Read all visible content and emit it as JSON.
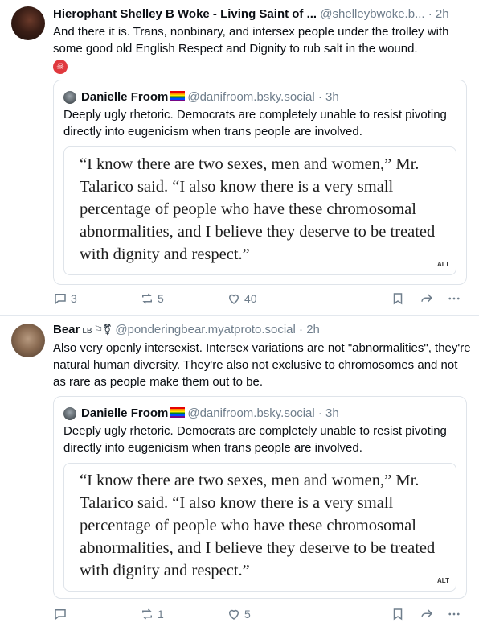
{
  "posts": [
    {
      "author_name": "Hierophant Shelley B Woke - Living Saint of ...",
      "author_handle": "@shelleybwoke.b...",
      "time": "2h",
      "text": "And there it is. Trans, nonbinary, and intersex people under the trolley with some good old English Respect and Dignity to rub salt in the wound.",
      "emoji": "devil-emoji",
      "quote": {
        "author_name": "Danielle Froom",
        "author_handle": "@danifroom.bsky.social",
        "time": "3h",
        "text": "Deeply ugly rhetoric. Democrats are completely unable to resist pivoting directly into eugenicism when trans people are involved.",
        "image_text": "“I know there are two sexes, men and women,” Mr. Talarico said. “I also know there is a very small percentage of people who have these chromosomal abnormalities, and I believe they deserve to be treated with dignity and respect.”",
        "alt_label": "ALT"
      },
      "actions": {
        "replies": "3",
        "reposts": "5",
        "likes": "40"
      }
    },
    {
      "author_name": "Bear",
      "author_badge": "LB",
      "author_flags": "⚐⚧",
      "author_handle": "@ponderingbear.myatproto.social",
      "time": "2h",
      "text": "Also very openly intersexist. Intersex variations are not \"abnormalities\", they're natural human diversity. They're also not exclusive to chromosomes and not as rare as people make them out to be.",
      "quote": {
        "author_name": "Danielle Froom",
        "author_handle": "@danifroom.bsky.social",
        "time": "3h",
        "text": "Deeply ugly rhetoric. Democrats are completely unable to resist pivoting directly into eugenicism when trans people are involved.",
        "image_text": "“I know there are two sexes, men and women,” Mr. Talarico said. “I also know there is a very small percentage of people who have these chromosomal abnormalities, and I believe they deserve to be treated with dignity and respect.”",
        "alt_label": "ALT"
      },
      "actions": {
        "replies": "",
        "reposts": "1",
        "likes": "5"
      }
    }
  ],
  "separator": "·",
  "icons": [
    "reply-icon",
    "repost-icon",
    "like-icon",
    "bookmark-icon",
    "share-icon",
    "more-icon"
  ],
  "colors": {
    "muted": "#6f7e8c",
    "border": "#dfe4ea",
    "text": "#0b0f14"
  }
}
